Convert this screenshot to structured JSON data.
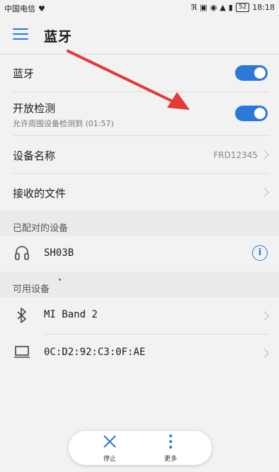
{
  "status_bar": {
    "carrier": "中国电信",
    "battery": "52",
    "time": "18:18"
  },
  "app_bar": {
    "title": "蓝牙"
  },
  "settings": {
    "bluetooth_label": "蓝牙",
    "discover_label": "开放检测",
    "discover_sub": "允许周围设备检测到 (01:57)",
    "device_name_label": "设备名称",
    "device_name_value": "FRD12345",
    "received_files_label": "接收的文件"
  },
  "paired": {
    "header": "已配对的设备",
    "devices": [
      {
        "name": "SH03B",
        "icon": "headset-icon"
      }
    ]
  },
  "available": {
    "header": "可用设备",
    "devices": [
      {
        "name": "MI Band 2",
        "icon": "bluetooth-icon"
      },
      {
        "name": "0C:D2:92:C3:0F:AE",
        "icon": "laptop-icon"
      }
    ]
  },
  "bottom_bar": {
    "stop_label": "停止",
    "more_label": "更多"
  },
  "colors": {
    "accent": "#2a78d8",
    "annotation_arrow": "#e53935"
  }
}
